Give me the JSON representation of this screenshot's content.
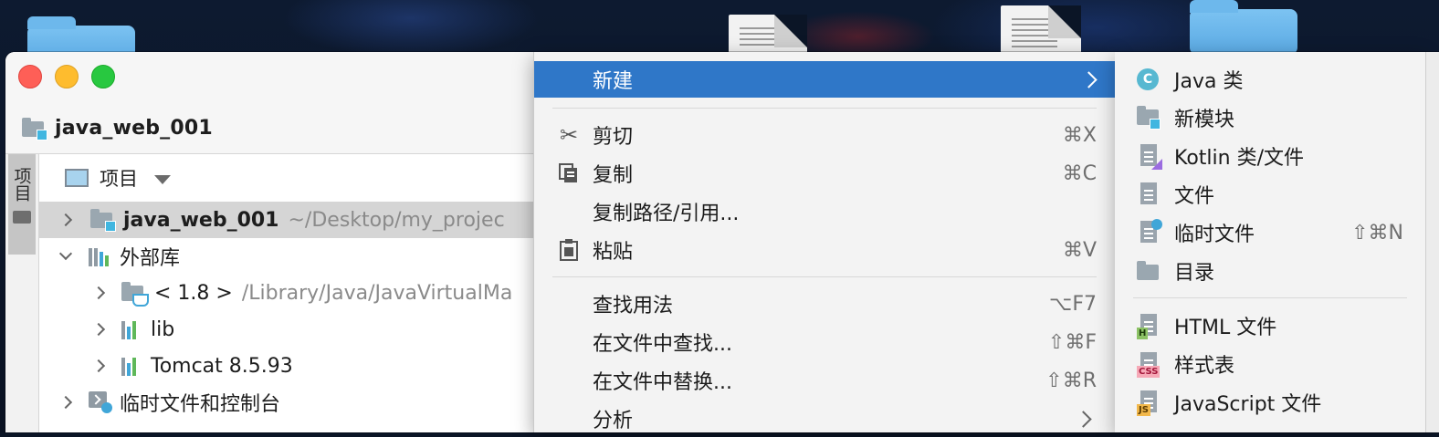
{
  "window": {
    "project_name": "java_web_001"
  },
  "project_panel": {
    "side_tab_label": "项目",
    "view_title": "项目",
    "tree": [
      {
        "label": "java_web_001",
        "path": "~/Desktop/my_projec",
        "expanded": false,
        "selected": true
      },
      {
        "label": "外部库",
        "expanded": true
      },
      {
        "label": "< 1.8 >",
        "path": "/Library/Java/JavaVirtualMa",
        "expanded": false
      },
      {
        "label": "lib",
        "expanded": false
      },
      {
        "label": "Tomcat 8.5.93",
        "expanded": false
      },
      {
        "label": "临时文件和控制台",
        "expanded": false
      }
    ]
  },
  "context_menu": {
    "items": [
      {
        "label": "新建",
        "shortcut": "",
        "icon": "",
        "submenu": true,
        "highlighted": true
      },
      {
        "label": "剪切",
        "shortcut": "⌘X",
        "icon": "scissors-icon"
      },
      {
        "label": "复制",
        "shortcut": "⌘C",
        "icon": "copy-icon"
      },
      {
        "label": "复制路径/引用...",
        "shortcut": "",
        "icon": ""
      },
      {
        "label": "粘贴",
        "shortcut": "⌘V",
        "icon": "clipboard-icon"
      },
      {
        "label": "查找用法",
        "shortcut": "⌥F7",
        "icon": ""
      },
      {
        "label": "在文件中查找...",
        "shortcut": "⇧⌘F",
        "icon": ""
      },
      {
        "label": "在文件中替换...",
        "shortcut": "⇧⌘R",
        "icon": ""
      },
      {
        "label": "分析",
        "shortcut": "",
        "icon": "",
        "submenu": true
      }
    ]
  },
  "new_submenu": {
    "items": [
      {
        "label": "Java 类",
        "icon": "java-class-icon",
        "shortcut": ""
      },
      {
        "label": "新模块",
        "icon": "module-folder-icon",
        "shortcut": ""
      },
      {
        "label": "Kotlin 类/文件",
        "icon": "kotlin-file-icon",
        "shortcut": ""
      },
      {
        "label": "文件",
        "icon": "file-icon",
        "shortcut": ""
      },
      {
        "label": "临时文件",
        "icon": "scratch-file-icon",
        "shortcut": "⇧⌘N"
      },
      {
        "label": "目录",
        "icon": "folder-icon",
        "shortcut": ""
      },
      {
        "label": "HTML 文件",
        "icon": "html-file-icon",
        "shortcut": "",
        "badge": "H"
      },
      {
        "label": "样式表",
        "icon": "css-file-icon",
        "shortcut": "",
        "badge": "CSS"
      },
      {
        "label": "JavaScript 文件",
        "icon": "js-file-icon",
        "shortcut": "",
        "badge": "JS"
      }
    ]
  },
  "colors": {
    "highlight": "#2f77c8",
    "java_icon": "#57b8d1",
    "module_accent": "#40b6e0"
  }
}
